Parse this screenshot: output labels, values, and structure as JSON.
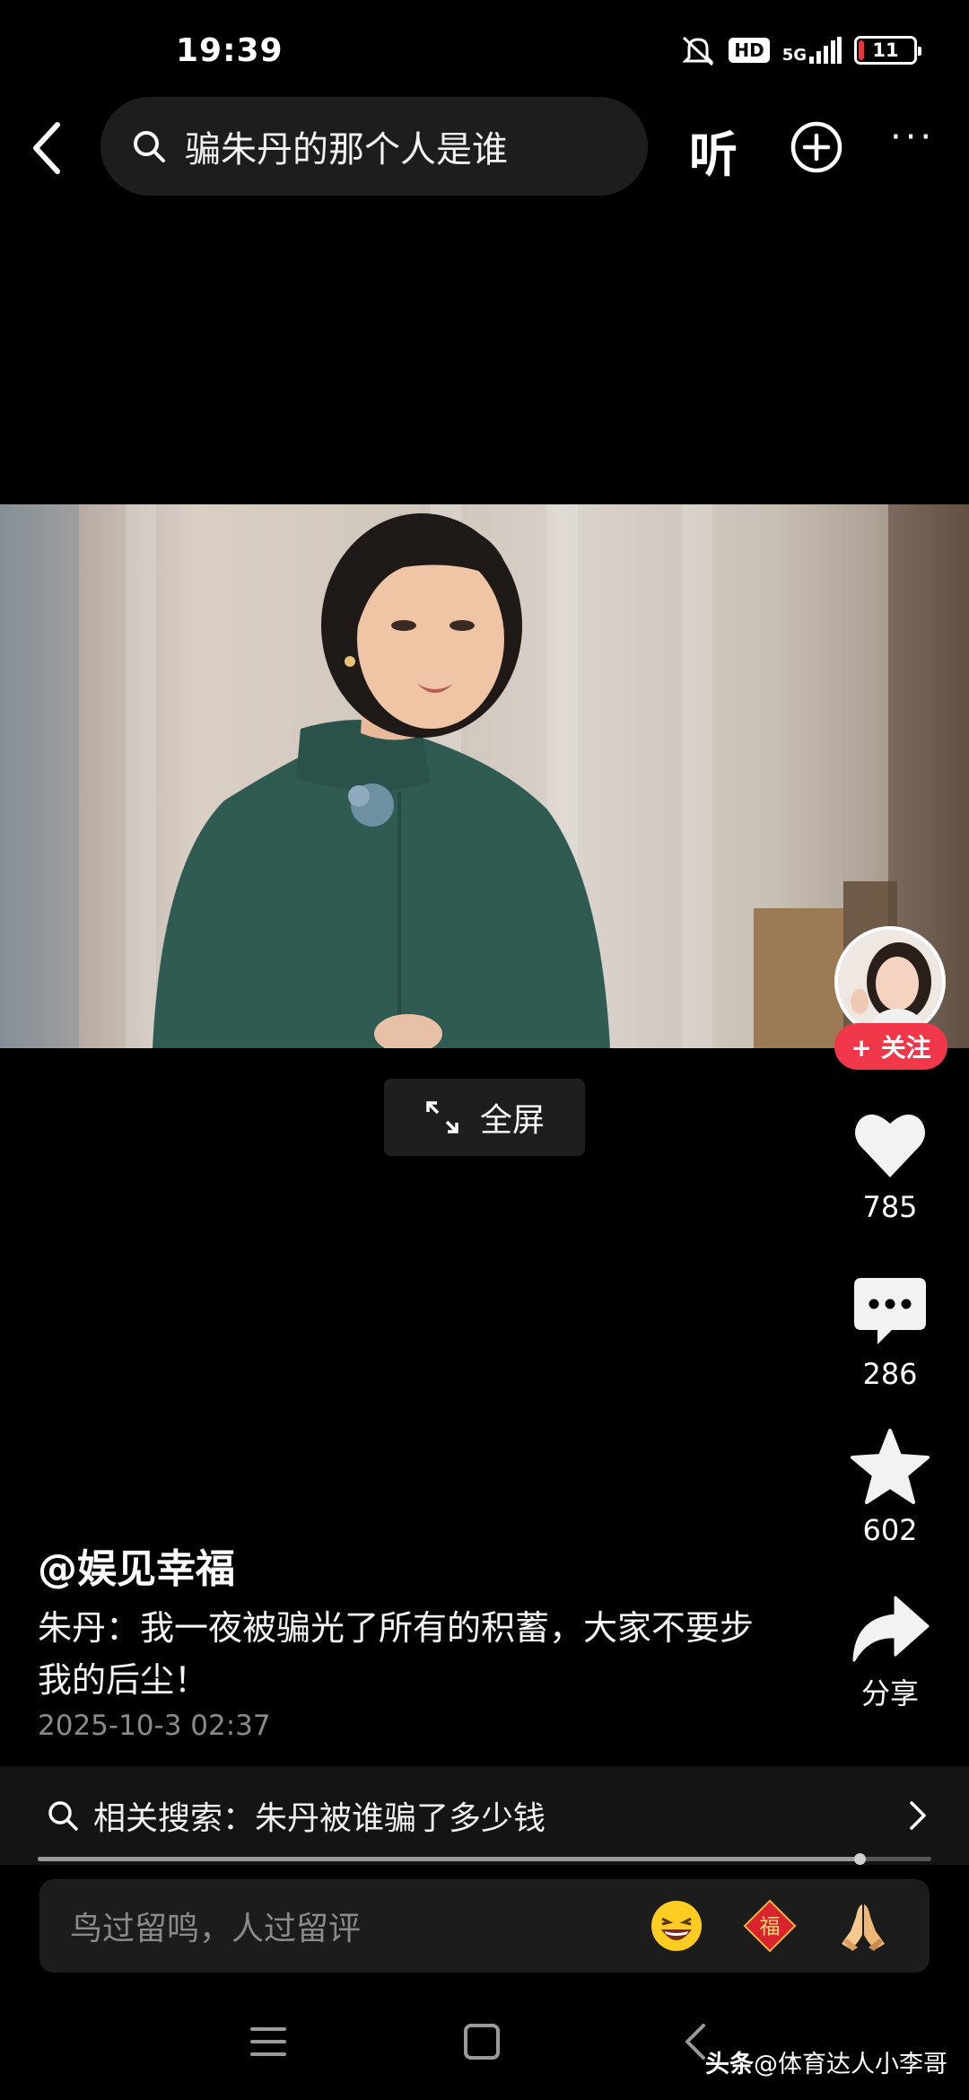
{
  "status_bar": {
    "time": "19:39",
    "hd_label": "HD",
    "network_label": "5G",
    "battery_level": "11"
  },
  "header": {
    "search_query": "骗朱丹的那个人是谁",
    "listen_label": "听",
    "more_label": "···"
  },
  "video": {
    "fullscreen_label": "全屏"
  },
  "author": {
    "follow_label": "+ 关注",
    "handle": "@娱见幸福"
  },
  "actions": {
    "likes": "785",
    "comments": "286",
    "favorites": "602",
    "share_label": "分享"
  },
  "post": {
    "caption": "朱丹：我一夜被骗光了所有的积蓄，大家不要步我的后尘！",
    "date": "2025-10-3 02:37"
  },
  "related": {
    "text": "相关搜索：朱丹被谁骗了多少钱"
  },
  "playback": {
    "progress_fraction": 0.92
  },
  "comment_input": {
    "placeholder": "鸟过留鸣，人过留评",
    "fu_label": "福"
  },
  "watermark": {
    "brand": "头条",
    "user": "@体育达人小李哥"
  },
  "colors": {
    "follow_red": "#f0384a",
    "background": "#000000"
  }
}
